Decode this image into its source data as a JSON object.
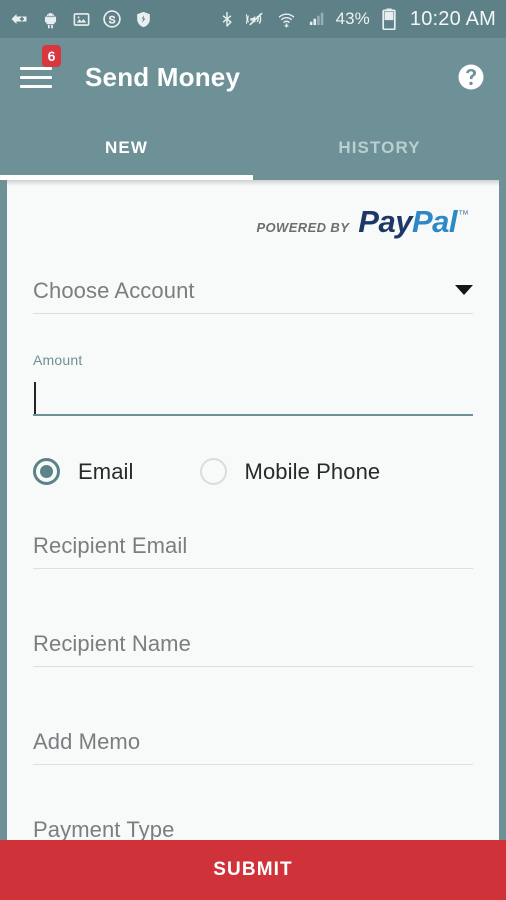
{
  "statusbar": {
    "left_icons": [
      {
        "name": "back-plus-icon",
        "glyph": "back-plus"
      },
      {
        "name": "android-robot-icon",
        "glyph": "android"
      },
      {
        "name": "image-icon",
        "glyph": "image"
      },
      {
        "name": "skype-icon",
        "glyph": "skype"
      },
      {
        "name": "shield-sync-icon",
        "glyph": "shield"
      }
    ],
    "right_icons": [
      {
        "name": "bluetooth-icon",
        "glyph": "bluetooth"
      },
      {
        "name": "mute-vibrate-icon",
        "glyph": "mute"
      },
      {
        "name": "wifi-icon",
        "glyph": "wifi"
      },
      {
        "name": "cell-signal-icon",
        "glyph": "signal"
      }
    ],
    "battery_percent": "43%",
    "clock": "10:20 AM"
  },
  "appbar": {
    "menu_badge_count": "6",
    "title": "Send Money",
    "help_icon": "help-circle-icon"
  },
  "tabs": [
    {
      "label": "NEW",
      "active": true
    },
    {
      "label": "HISTORY",
      "active": false
    }
  ],
  "branding": {
    "powered_by": "POWERED BY",
    "pay": "Pay",
    "pal": "Pal",
    "tm": "™"
  },
  "form": {
    "choose_account": {
      "label": "Choose Account",
      "value": "",
      "caret_icon": "chevron-down-icon"
    },
    "amount": {
      "float_label": "Amount",
      "value": "",
      "focused": true
    },
    "recipient_type": {
      "options": [
        {
          "label": "Email",
          "selected": true
        },
        {
          "label": "Mobile Phone",
          "selected": false
        }
      ]
    },
    "recipient_email": {
      "label": "Recipient Email",
      "value": ""
    },
    "recipient_name": {
      "label": "Recipient Name",
      "value": ""
    },
    "add_memo": {
      "label": "Add Memo",
      "value": ""
    },
    "payment_type": {
      "label": "Payment Type",
      "value": ""
    }
  },
  "submit": {
    "label": "SUBMIT"
  },
  "colors": {
    "teal": "#6d9196",
    "teal_dark": "#5d8187",
    "red": "#cf3339",
    "badge_red": "#d9373e",
    "paypal_navy": "#1d3767",
    "paypal_blue": "#2c89c6"
  }
}
